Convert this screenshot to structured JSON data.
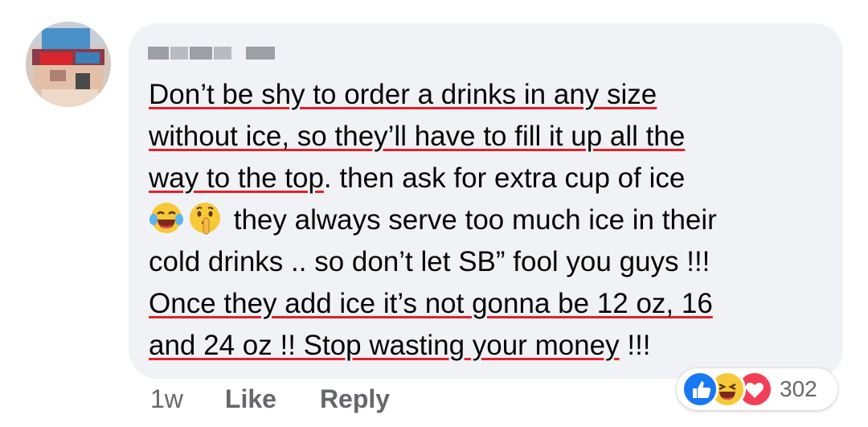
{
  "comment": {
    "author_name": "",
    "lines": [
      {
        "underlined": "Don’t be shy to order a drinks  in any size",
        "rest": ""
      },
      {
        "underlined": "without ice, so they’ll have to fill it up all the",
        "rest": ""
      },
      {
        "underlined": "way to the top",
        "rest": ". then ask for extra cup of ice"
      },
      {
        "emoji": [
          "laughing-crying-emoji",
          "shushing-face-emoji"
        ],
        "underlined": "",
        "rest": " they always serve too much ice in their"
      },
      {
        "underlined": "",
        "rest": "cold drinks .. so don’t let SB” fool you guys !!!"
      },
      {
        "underlined": "Once they add ice it’s not gonna be 12 oz, 16",
        "rest": ""
      },
      {
        "underlined": "and 24 oz !! Stop wasting your money",
        "rest": " !!!"
      }
    ],
    "underline_color": "#e0222a"
  },
  "actions": {
    "timestamp": "1w",
    "like_label": "Like",
    "reply_label": "Reply"
  },
  "reactions": {
    "icons": [
      "like-icon",
      "haha-icon",
      "love-icon"
    ],
    "count": "302",
    "colors": {
      "like": "#1877f2",
      "haha": "#f7c938",
      "love": "#f33e58"
    }
  }
}
